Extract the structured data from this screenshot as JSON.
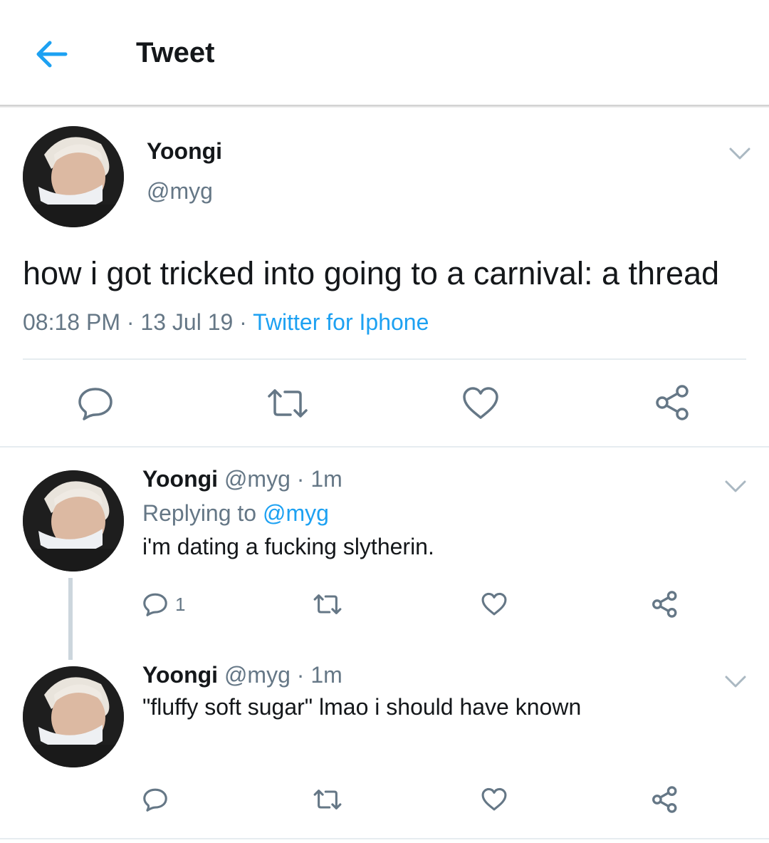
{
  "header": {
    "title": "Tweet",
    "back_icon": "arrow-left-icon"
  },
  "colors": {
    "accent": "#1da1f2",
    "text": "#14171a",
    "muted": "#657786",
    "divider": "#e6ecf0"
  },
  "main_tweet": {
    "name": "Yoongi",
    "handle": "@myg",
    "text": "how i got tricked into going to a carnival: a thread",
    "time": "08:18 PM",
    "date": "13 Jul 19",
    "source": "Twitter for Iphone",
    "sep": "·"
  },
  "replies": [
    {
      "name": "Yoongi",
      "handle": "@myg",
      "time": "1m",
      "replying_prefix": "Replying to",
      "replying_to": "@myg",
      "text": "i'm dating a fucking slytherin.",
      "reply_count": "1"
    },
    {
      "name": "Yoongi",
      "handle": "@myg",
      "time": "1m",
      "text": "\"fluffy soft sugar\" lmao i should have known"
    }
  ]
}
